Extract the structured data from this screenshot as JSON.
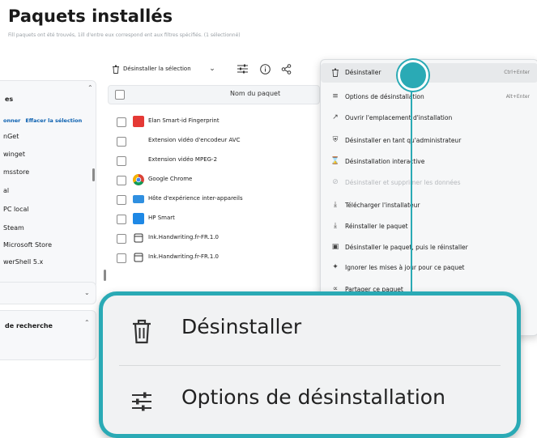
{
  "header": {
    "title": "Paquets installés",
    "subtitle": "Fill paquets ont été trouvés, 1ill d'entre eux correspond ent aux filtres spécifiés. (1 sélectionné)"
  },
  "filters": {
    "sources_head": "es",
    "select_all": "onner",
    "clear_selection": "Effacer la sélection",
    "sources": [
      "nGet",
      "winget",
      "msstore",
      "al",
      "PC local",
      "Steam",
      "Microsoft Store",
      "werShell 5.x"
    ],
    "search_head": "de recherche"
  },
  "toolbar": {
    "uninstall_selection": "Désinstaller la sélection"
  },
  "table": {
    "column_name": "Nom du paquet",
    "rows": [
      {
        "name": "Elan Smart-id Fingerprint",
        "icon": "fingerprint-app-icon",
        "color": "#e53935"
      },
      {
        "name": "Extension vidéo d'encodeur AVC",
        "icon": "blank-app-icon",
        "color": ""
      },
      {
        "name": "Extension vidéo MPEG-2",
        "icon": "blank-app-icon",
        "color": ""
      },
      {
        "name": "Google Chrome",
        "icon": "chrome-icon",
        "color": ""
      },
      {
        "name": "Hôte d'expérience inter-appareils",
        "icon": "cross-device-icon",
        "color": "#2f8fe0"
      },
      {
        "name": "HP Smart",
        "icon": "hp-smart-icon",
        "color": "#1e88e5"
      },
      {
        "name": "Ink.Handwriting.fr-FR.1.0",
        "icon": "package-icon",
        "color": ""
      },
      {
        "name": "Ink.Handwriting.fr-FR.1.0",
        "icon": "package-icon",
        "color": ""
      }
    ]
  },
  "context_menu": {
    "items": [
      {
        "label": "Désinstaller",
        "shortcut": "Ctrl+Enter",
        "icon": "trash-icon",
        "disabled": false
      },
      {
        "label": "Options de désinstallation",
        "shortcut": "Alt+Enter",
        "icon": "sliders-icon",
        "disabled": false
      },
      {
        "label": "Ouvrir l'emplacement d'installation",
        "shortcut": "",
        "icon": "open-location-icon",
        "disabled": false
      },
      {
        "label": "Désinstaller en tant qu'administrateur",
        "shortcut": "",
        "icon": "shield-icon",
        "disabled": false
      },
      {
        "label": "Désinstallation interactive",
        "shortcut": "",
        "icon": "interactive-icon",
        "disabled": false
      },
      {
        "label": "Désinstaller et supprimer les données",
        "shortcut": "",
        "icon": "erase-icon",
        "disabled": true
      },
      {
        "label": "Télécharger l'installateur",
        "shortcut": "",
        "icon": "download-icon",
        "disabled": false
      },
      {
        "label": "Réinstaller le paquet",
        "shortcut": "",
        "icon": "reinstall-icon",
        "disabled": false
      },
      {
        "label": "Désinstaller le paquet, puis le réinstaller",
        "shortcut": "",
        "icon": "trash-icon",
        "disabled": false
      },
      {
        "label": "Ignorer les mises à jour pour ce paquet",
        "shortcut": "",
        "icon": "pin-icon",
        "disabled": false
      },
      {
        "label": "Partager ce paquet",
        "shortcut": "",
        "icon": "share-icon",
        "disabled": false
      }
    ]
  },
  "zoom": {
    "item1": "Désinstaller",
    "item2": "Options de désinstallation"
  },
  "colors": {
    "accent": "#2aaab5",
    "link": "#0b60b0"
  }
}
